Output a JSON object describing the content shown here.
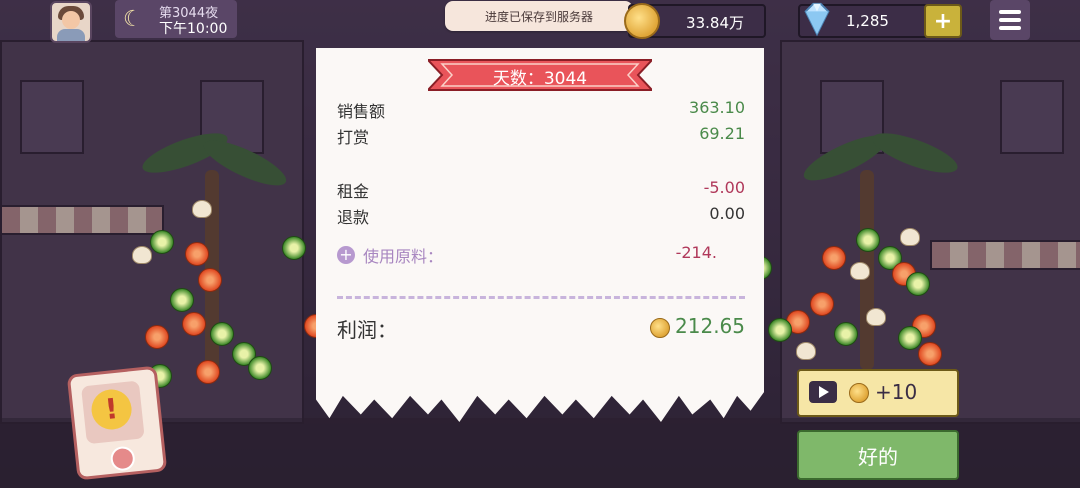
{
  "hud": {
    "night_label": "第3044夜",
    "time": "下午10:00",
    "save_toast": "进度已保存到服务器",
    "money": "33.84万",
    "gems": "1,285",
    "plus_label": "+"
  },
  "receipt": {
    "day_banner": "天数：3044",
    "rows": [
      {
        "label": "销售额",
        "value": "363.10"
      },
      {
        "label": "打赏",
        "value": "69.21"
      },
      {
        "label": "租金",
        "value": "-5.00"
      },
      {
        "label": "退款",
        "value": "0.00"
      }
    ],
    "ingredients_label": "使用原料：",
    "ingredients_value": "-214.",
    "profit_label": "利润：",
    "profit_value": "212.65"
  },
  "buttons": {
    "ad_reward": "+10",
    "ok": "好的"
  },
  "colors": {
    "positive": "#4a8a4a",
    "negative": "#b0385a",
    "banner": "#e9545a",
    "ok_button": "#7fb86a",
    "ad_button": "#f6e6a6"
  },
  "icons": [
    "moon-icon",
    "coin-icon",
    "gem-icon",
    "plus-icon",
    "menu-icon",
    "add-circle-icon",
    "play-icon",
    "alert-icon"
  ]
}
